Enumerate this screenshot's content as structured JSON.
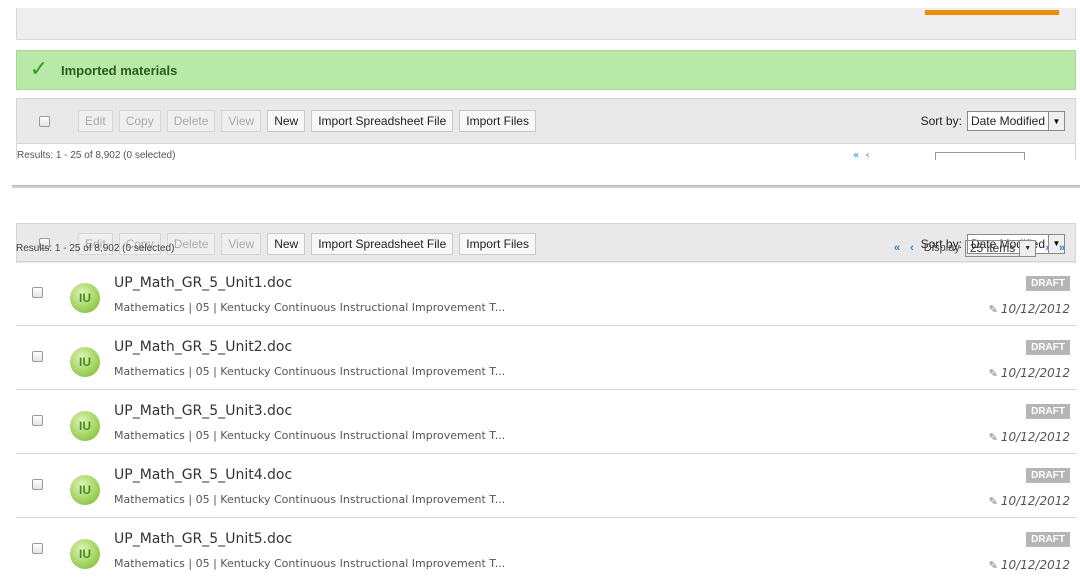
{
  "notice": {
    "icon": "checkmark-icon",
    "message": "Imported materials"
  },
  "toolbar": {
    "edit": "Edit",
    "copy": "Copy",
    "delete": "Delete",
    "view": "View",
    "new": "New",
    "import_spreadsheet": "Import Spreadsheet File",
    "import_files": "Import Files",
    "sort_label": "Sort by:",
    "sort_value": "Date Modified"
  },
  "results": {
    "summary": "Results: 1 - 25 of 8,902 (0 selected)",
    "summary_cut": "Results: 1 - 25 of 8,902 (0 selected)",
    "display_label": "Display",
    "display_value": "25 items",
    "first": "«",
    "prev": "‹",
    "next": "›",
    "last": "»"
  },
  "items": [
    {
      "title": "UP_Math_GR_5_Unit1.doc",
      "meta": "Mathematics | 05 | Kentucky Continuous Instructional Improvement T...",
      "status": "DRAFT",
      "date": "10/12/2012"
    },
    {
      "title": "UP_Math_GR_5_Unit2.doc",
      "meta": "Mathematics | 05 | Kentucky Continuous Instructional Improvement T...",
      "status": "DRAFT",
      "date": "10/12/2012"
    },
    {
      "title": "UP_Math_GR_5_Unit3.doc",
      "meta": "Mathematics | 05 | Kentucky Continuous Instructional Improvement T...",
      "status": "DRAFT",
      "date": "10/12/2012"
    },
    {
      "title": "UP_Math_GR_5_Unit4.doc",
      "meta": "Mathematics | 05 | Kentucky Continuous Instructional Improvement T...",
      "status": "DRAFT",
      "date": "10/12/2012"
    },
    {
      "title": "UP_Math_GR_5_Unit5.doc",
      "meta": "Mathematics | 05 | Kentucky Continuous Instructional Improvement T...",
      "status": "DRAFT",
      "date": "10/12/2012"
    }
  ],
  "colors": {
    "notice_bg": "#b9e9a8",
    "accent": "#f08c00",
    "link": "#2a7fd4",
    "badge": "#b5b5b5"
  }
}
